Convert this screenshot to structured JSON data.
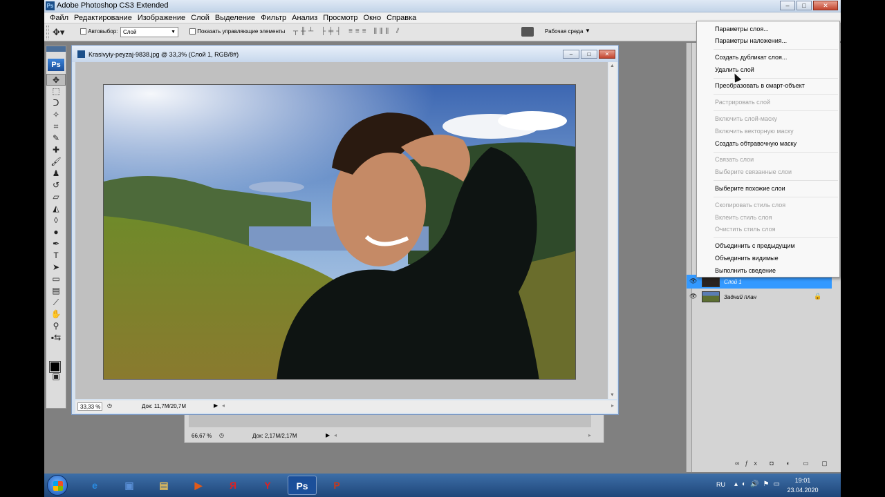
{
  "app": {
    "title": "Adobe Photoshop CS3 Extended",
    "logo": "Ps"
  },
  "window_buttons": {
    "minimize": "–",
    "maximize": "□",
    "close": "✕"
  },
  "menu": [
    "Файл",
    "Редактирование",
    "Изображение",
    "Слой",
    "Выделение",
    "Фильтр",
    "Анализ",
    "Просмотр",
    "Окно",
    "Справка"
  ],
  "options": {
    "autoselect_label": "Автовыбор:",
    "autoselect_value": "Слой",
    "show_controls_label": "Показать управляющие элементы",
    "workspace_label": "Рабочая среда"
  },
  "document": {
    "title": "Krasivyiy-peyzaj-9838.jpg @ 33,3% (Слой 1, RGB/8#)",
    "zoom": "33,33 %",
    "doc_info": "Док: 11,7M/20,7M"
  },
  "back_document": {
    "zoom": "66,67 %",
    "doc_info": "Док: 2,17M/2,17M"
  },
  "layers": [
    {
      "name": "Слой 1",
      "selected": true,
      "locked": false
    },
    {
      "name": "Задний план",
      "selected": false,
      "locked": true
    }
  ],
  "context_menu": [
    {
      "label": "Параметры слоя...",
      "enabled": true
    },
    {
      "label": "Параметры наложения...",
      "enabled": true
    },
    {
      "label": "Создать дубликат слоя...",
      "enabled": true
    },
    {
      "label": "Удалить слой",
      "enabled": true
    },
    {
      "label": "Преобразовать в смарт-объект",
      "enabled": true
    },
    {
      "label": "Растрировать слой",
      "enabled": false
    },
    {
      "label": "Включить слой-маску",
      "enabled": false
    },
    {
      "label": "Включить векторную маску",
      "enabled": false
    },
    {
      "label": "Создать обтравочную маску",
      "enabled": true
    },
    {
      "label": "Связать слои",
      "enabled": false
    },
    {
      "label": "Выберите связанные слои",
      "enabled": false
    },
    {
      "label": "Выберите похожие слои",
      "enabled": true
    },
    {
      "label": "Скопировать стиль слоя",
      "enabled": false
    },
    {
      "label": "Вклеить стиль слоя",
      "enabled": false
    },
    {
      "label": "Очистить стиль слоя",
      "enabled": false
    },
    {
      "label": "Объединить с предыдущим",
      "enabled": true
    },
    {
      "label": "Объединить видимые",
      "enabled": true
    },
    {
      "label": "Выполнить сведение",
      "enabled": true
    }
  ],
  "taskbar": {
    "apps": [
      {
        "icon": "internet-explorer-icon",
        "glyph": "e",
        "color": "#2a8ae0"
      },
      {
        "icon": "computer-icon",
        "glyph": "▣",
        "color": "#5a8fd6"
      },
      {
        "icon": "folder-icon",
        "glyph": "▤",
        "color": "#e8c05a"
      },
      {
        "icon": "media-player-icon",
        "glyph": "▶",
        "color": "#e05a1a"
      },
      {
        "icon": "yandex-icon",
        "glyph": "Я",
        "color": "#e02020"
      },
      {
        "icon": "yandex-browser-icon",
        "glyph": "Y",
        "color": "#e02020"
      },
      {
        "icon": "photoshop-icon",
        "glyph": "Ps",
        "color": "#1b4f9a"
      },
      {
        "icon": "powerpoint-icon",
        "glyph": "P",
        "color": "#c9391b"
      }
    ],
    "active_app": 6,
    "lang": "RU",
    "time": "19:01",
    "date": "23.04.2020"
  }
}
